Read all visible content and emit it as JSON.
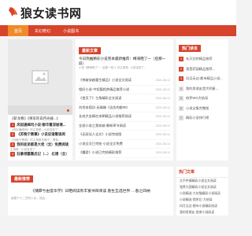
{
  "brand": {
    "title": "狼女读书网",
    "accent": "#d6442c"
  },
  "nav": [
    "首页",
    "玄幻奇幻",
    "小说图书"
  ],
  "hero": {
    "caption": "暂无图片"
  },
  "left_list": [
    {
      "title": "《斩龙尊》《将军的白月光被...》",
      "sub": ""
    },
    {
      "badge": "1",
      "title": "风狱通缉司小说-御华重深秘境...",
      "sub": "《风狱通缉司》的主角是...小说讲述了..."
    },
    {
      "badge": "2",
      "title": "《苏晚宁萧慕》小说说诸看读阅",
      "sub": "《苏晚宁萧慕》的主角是苏晚宁、萧慕..."
    },
    {
      "badge": "3",
      "title": "我的徒弟都是大佬（全）免费阅读",
      "sub": "主角是...小说讲述了..."
    },
    {
      "badge": "4",
      "title": "狂暴领露重启记（...） 红楼（全）",
      "sub": "..."
    }
  ],
  "mid": {
    "section": "最新文章",
    "featured_title": "今日热推精彩小说完本最新推荐：樽海晒了一（后那一段）",
    "featured_desc": "小说《樽海晒了一（后那一段）》的主角是...小说讲述了...",
    "items": [
      {
        "t": "《快破穿越重生精品》小说全文阅读",
        "d": "2021-08-12"
      },
      {
        "t": "相好小说·中短篇相关精品推荐小说",
        "d": "2021-08-12"
      },
      {
        "t": "《首页了》主角精彩全文阅读",
        "d": "2021-08-12"
      },
      {
        "t": "刘秀本宿坊·无端端《苦恋的都市》",
        "d": "2021-08-12"
      },
      {
        "t": "长成大女婿在宋朝精品小说推荐阅读",
        "d": "2021-08-12"
      },
      {
        "t": "全部小说之我穿越·最新章节阅读",
        "d": "2021-08-12"
      },
      {
        "t": "《无双佳人全文》小说完结版",
        "d": "2021-08-12"
      },
      {
        "t": "小说全文已完结·小说全文免费",
        "d": "2021-08-12"
      },
      {
        "t": "《魔君》小说已完结精彩推荐",
        "d": "2021-08-12"
      }
    ]
  },
  "right": {
    "section": "热门读本",
    "items": [
      "玄天剑宗精品推荐",
      "我是药园精品推荐...",
      "风月无边·都市精品小说...",
      "我的男朋友是大明星...",
      "修罗WG大结局",
      "小说全集完整版",
      "精彩小说排行榜"
    ]
  },
  "bottom": {
    "section": "最新推荐",
    "title": "《捕莽兮由蛮华学》日晒阅读有丰富书目阅读 春生互选世界·…春之四纳",
    "desc": "我是个十二岁的少女，然后...",
    "right_section": "热门文章",
    "right_items": [
      "太平杵情精彩小说全文阅读",
      "强界大国精彩小说全文阅读",
      "小说精选·大灰猫精彩小说阅读",
      "小说精选·猎杀后·大结局",
      "风月无边·都市小说精彩阅读",
      "我的男朋友·首席小说阅读"
    ]
  }
}
